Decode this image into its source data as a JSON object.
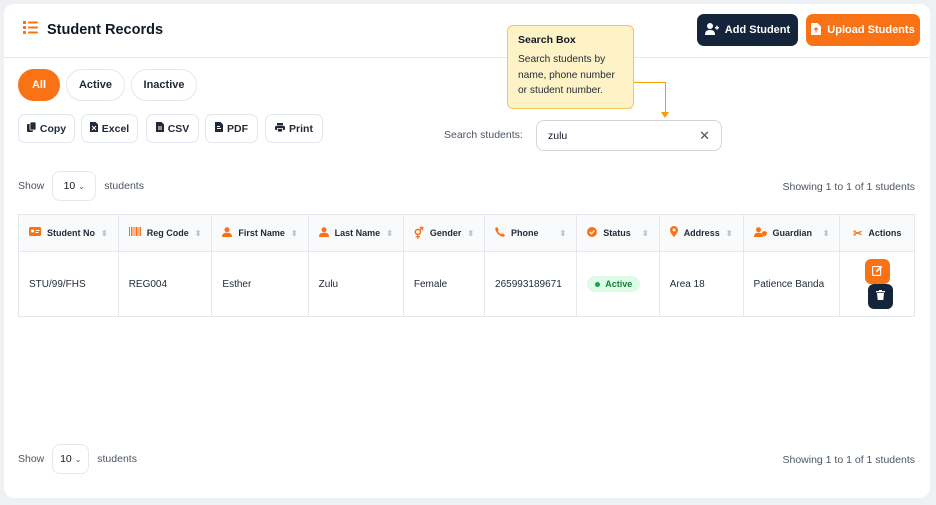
{
  "header": {
    "title": "Student Records",
    "list_icon": "list-icon",
    "add_button": "Add Student",
    "upload_button": "Upload Students"
  },
  "filter_tabs": [
    {
      "label": "All",
      "active": true
    },
    {
      "label": "Active",
      "active": false
    },
    {
      "label": "Inactive",
      "active": false
    }
  ],
  "export_buttons": [
    "Copy",
    "Excel",
    "CSV",
    "PDF",
    "Print"
  ],
  "search": {
    "label": "Search students:",
    "value": "zulu"
  },
  "tooltip": {
    "title": "Search Box",
    "lines": [
      "Search students by",
      "name, phone number",
      "or student number."
    ]
  },
  "pagination_top": {
    "show_label": "Show",
    "per_page": "10",
    "suffix": "students",
    "showing": "Showing 1 to 1 of 1 students"
  },
  "pagination_bottom": {
    "show_label": "Show",
    "per_page": "10",
    "suffix": "students",
    "showing": "Showing 1 to 1 of 1 students"
  },
  "table": {
    "columns": [
      "Student No",
      "Reg Code",
      "First Name",
      "Last Name",
      "Gender",
      "Phone",
      "Status",
      "Address",
      "Guardian",
      "Actions"
    ],
    "rows": [
      {
        "student_no": "STU/99/FHS",
        "reg_code": "REG004",
        "first_name": "Esther",
        "last_name": "Zulu",
        "gender": "Female",
        "phone": "265993189671",
        "status": "Active",
        "address": "Area 18",
        "guardian": "Patience Banda"
      }
    ]
  },
  "colors": {
    "accent": "#f97316",
    "navy": "#13243b",
    "status_active_bg": "#dcfce7",
    "status_active_text": "#15803d",
    "tooltip_bg": "#fef3c7"
  }
}
